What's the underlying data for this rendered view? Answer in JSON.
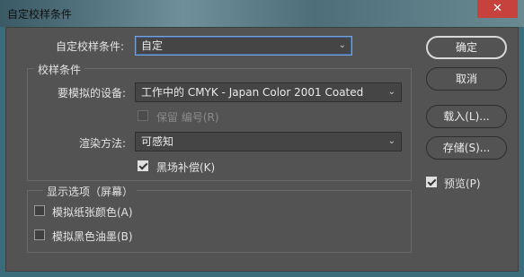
{
  "window": {
    "title": "自定校样条件",
    "close_icon": "✕"
  },
  "custom_condition": {
    "label": "自定校样条件:",
    "value": "自定"
  },
  "proof_conditions": {
    "group_title": "校样条件",
    "device_label": "要模拟的设备:",
    "device_value": "工作中的 CMYK - Japan Color 2001 Coated",
    "preserve_numbers_label": "保留 编号(R)",
    "preserve_numbers_checked": false,
    "preserve_numbers_enabled": false,
    "rendering_intent_label": "渲染方法:",
    "rendering_intent_value": "可感知",
    "black_point_label": "黑场补偿(K)",
    "black_point_checked": true
  },
  "display_options": {
    "group_title": "显示选项（屏幕）",
    "simulate_paper_label": "模拟纸张颜色(A)",
    "simulate_paper_checked": false,
    "simulate_black_label": "模拟黑色油墨(B)",
    "simulate_black_checked": false
  },
  "buttons": {
    "ok": "确定",
    "cancel": "取消",
    "load": "载入(L)...",
    "save": "存储(S)..."
  },
  "preview": {
    "label": "预览(P)",
    "checked": true
  }
}
